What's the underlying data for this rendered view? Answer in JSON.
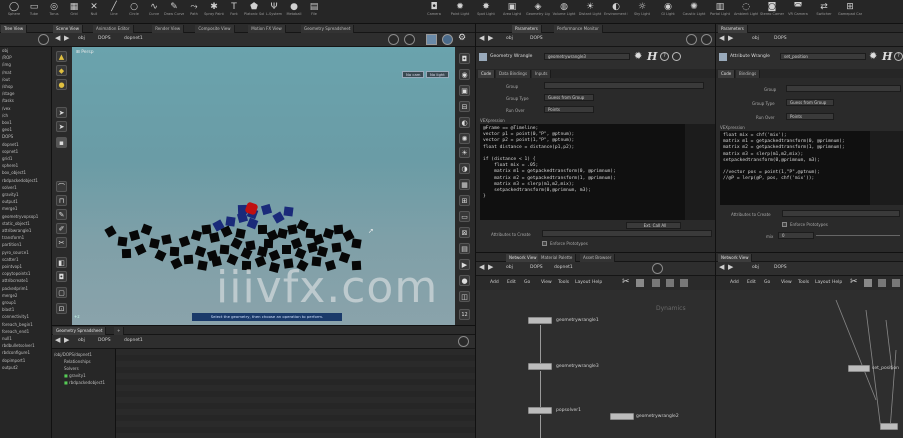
{
  "shelf": {
    "left_tools": [
      {
        "icon": "sphere-icon",
        "glyph": "◯",
        "label": "Sphere"
      },
      {
        "icon": "tube-icon",
        "glyph": "▭",
        "label": "Tube"
      },
      {
        "icon": "torus-icon",
        "glyph": "◎",
        "label": "Torus"
      },
      {
        "icon": "grid-icon",
        "glyph": "▦",
        "label": "Grid"
      },
      {
        "icon": "null-icon",
        "glyph": "✕",
        "label": "Null"
      },
      {
        "icon": "line-icon",
        "glyph": "╱",
        "label": "Line"
      },
      {
        "icon": "circle-icon",
        "glyph": "○",
        "label": "Circle"
      },
      {
        "icon": "curve-icon",
        "glyph": "∿",
        "label": "Curve"
      },
      {
        "icon": "drawcurve-icon",
        "glyph": "✎",
        "label": "Draw Curve"
      },
      {
        "icon": "path-icon",
        "glyph": "⤳",
        "label": "Path"
      },
      {
        "icon": "spray-paint-icon",
        "glyph": "✱",
        "label": "Spray Paint"
      },
      {
        "icon": "font-icon",
        "glyph": "T",
        "label": "Font"
      },
      {
        "icon": "platonic-icon",
        "glyph": "⬟",
        "label": "Platonic Solids"
      },
      {
        "icon": "lsystem-icon",
        "glyph": "Ψ",
        "label": "L-System"
      },
      {
        "icon": "metaball-icon",
        "glyph": "●",
        "label": "Metaball"
      },
      {
        "icon": "file-icon",
        "glyph": "▤",
        "label": "File"
      }
    ],
    "right_tools": [
      {
        "icon": "camera-icon",
        "glyph": "◘",
        "label": "Camera"
      },
      {
        "icon": "point-light-icon",
        "glyph": "✹",
        "label": "Point Light"
      },
      {
        "icon": "spot-light-icon",
        "glyph": "✸",
        "label": "Spot Light"
      },
      {
        "icon": "area-light-icon",
        "glyph": "▣",
        "label": "Area Light"
      },
      {
        "icon": "geometry-light-icon",
        "glyph": "◈",
        "label": "Geometry Light"
      },
      {
        "icon": "volume-light-icon",
        "glyph": "◍",
        "label": "Volume Light"
      },
      {
        "icon": "distant-light-icon",
        "glyph": "☀",
        "label": "Distant Light"
      },
      {
        "icon": "env-light-icon",
        "glyph": "◐",
        "label": "Environment Light"
      },
      {
        "icon": "sky-light-icon",
        "glyph": "☼",
        "label": "Sky Light"
      },
      {
        "icon": "gi-light-icon",
        "glyph": "◉",
        "label": "GI Light"
      },
      {
        "icon": "caustic-light-icon",
        "glyph": "✺",
        "label": "Caustic Light"
      },
      {
        "icon": "portal-light-icon",
        "glyph": "▥",
        "label": "Portal Light"
      },
      {
        "icon": "ambient-light-icon",
        "glyph": "◌",
        "label": "Ambient Light"
      },
      {
        "icon": "stereo-camera-icon",
        "glyph": "◙",
        "label": "Stereo Camera"
      },
      {
        "icon": "vr-camera-icon",
        "glyph": "◚",
        "label": "VR Camera"
      },
      {
        "icon": "switcher-icon",
        "glyph": "⇄",
        "label": "Switcher"
      },
      {
        "icon": "gamepad-camera-icon",
        "glyph": "⊞",
        "label": "Gamepad Camera"
      }
    ]
  },
  "left_tree": {
    "tab": "Tree View",
    "items": [
      "obj",
      "/ROP",
      "/img",
      "/mat",
      "/out",
      "/shop",
      "/stage",
      "/tasks",
      "/vex",
      "/ch",
      "box1",
      "geo1",
      "DOPS",
      "dopnet1",
      "sopnet1",
      "grid1",
      "sphere1",
      "box_object1",
      "rbdpackedobject1",
      "solver1",
      "gravity1",
      "output1",
      "merge1",
      "geometryvopsop1",
      "static_object1",
      "attribwrangle1",
      "transform1",
      "partition1",
      "pyro_source1",
      "scatter1",
      "pointvop1",
      "copytopoints1",
      "attribcreate1",
      "packedprim1",
      "merge2",
      "group1",
      "blast1",
      "connectivity1",
      "foreach_begin1",
      "foreach_end1",
      "null1",
      "rbdbulletsolver1",
      "rbdconfigure1",
      "dopimport1",
      "output2"
    ]
  },
  "viewport": {
    "tabs": [
      "Scene View",
      "Animation Editor",
      "Render View",
      "Composite View",
      "Motion FX View",
      "Geometry Spreadsheet"
    ],
    "path": [
      "obj",
      "DOPS",
      "dopnet1"
    ],
    "camera_label": "Persp",
    "cam_menu": "No cam",
    "light_menu": "No light",
    "status_text": "Select the geometry, then choose an operation to perform."
  },
  "spreadsheet": {
    "tab": "Geometry Spreadsheet",
    "path": [
      "obj",
      "DOPS",
      "dopnet1"
    ],
    "tree_root": "/obj/DOPS/dopnet1",
    "tree_items": [
      "Relationships",
      "Solvers",
      "gravity1",
      "rbdpackedobject1"
    ]
  },
  "wrangle1": {
    "tabs": [
      "Parameters",
      "Performance Monitor"
    ],
    "path": [
      "obj",
      "DOPS"
    ],
    "node_type": "Geometry Wrangle",
    "node_name": "geometrywrangle3",
    "param_tabs": [
      "Code",
      "Data Bindings",
      "Inputs"
    ],
    "fields": [
      {
        "label": "Group",
        "value": ""
      },
      {
        "label": "Group Type",
        "value": "Guess from Group"
      },
      {
        "label": "Run Over",
        "value": "Points"
      }
    ],
    "vexpression_label": "VEXpression",
    "code": "@Frame == @Timeline;\nvector p1 = point(0,\"P\", @ptnum);\nvector p2 = point(1,\"P\", @ptnum);\nfloat distance = distance(p1,p2);\n\nif (distance < 1) {\n    float mix = .05;\n    matrix m1 = getpackedtransform(0, @primnum);\n    matrix m2 = getpackedtransform(1, @primnum);\n    matrix m3 = slerp(m1,m2,mix);\n    setpackedtransform(0,@primnum, m3);\n}",
    "button": "Ext. Call All",
    "attrib_label": "Attributes to Create",
    "enforce_label": "Enforce Prototypes"
  },
  "wrangle2": {
    "path": [
      "obj",
      "DOPS"
    ],
    "node_type": "Attribute Wrangle",
    "node_name": "set_position",
    "param_tabs": [
      "Code",
      "Bindings"
    ],
    "fields": [
      {
        "label": "Group",
        "value": ""
      },
      {
        "label": "Group Type",
        "value": "Guess from Group"
      },
      {
        "label": "Run Over",
        "value": "Points"
      }
    ],
    "vexpression_label": "VEXpression",
    "code": "float mix = chf('mix');\nmatrix m1 = getpackedtransform(0, @primnum);\nmatrix m2 = getpackedtransform(1, @primnum);\nmatrix m3 = slerp(m1,m2,mix);\nsetpackedtransform(0,@primnum, m3);\n\n//vector pos = point(1,\"P\",@ptnum);\n//@P = lerp(@P, pos, chf('mix'));",
    "attrib_label": "Attributes to Create",
    "enforce_label": "Enforce Prototypes",
    "mix_label": "mix",
    "mix_value": "0"
  },
  "network1": {
    "tabs": [
      "Network View",
      "Material Palette",
      "Asset Browser"
    ],
    "path": [
      "obj",
      "DOPS",
      "dopnet1"
    ],
    "menu": [
      "Add",
      "Edit",
      "Go",
      "View",
      "Tools",
      "Layout",
      "Help"
    ],
    "context_label": "Dynamics",
    "nodes": [
      "geometrywrangle1",
      "geometrywrangle3",
      "popsolver1",
      "geometrywrangle2"
    ]
  },
  "network2": {
    "path": [
      "obj",
      "DOPS"
    ],
    "menu": [
      "Add",
      "Edit",
      "Go",
      "View",
      "Tools",
      "Layout",
      "Help"
    ],
    "nodes": [
      "set_position"
    ]
  },
  "watermark": "iiivfx.com"
}
